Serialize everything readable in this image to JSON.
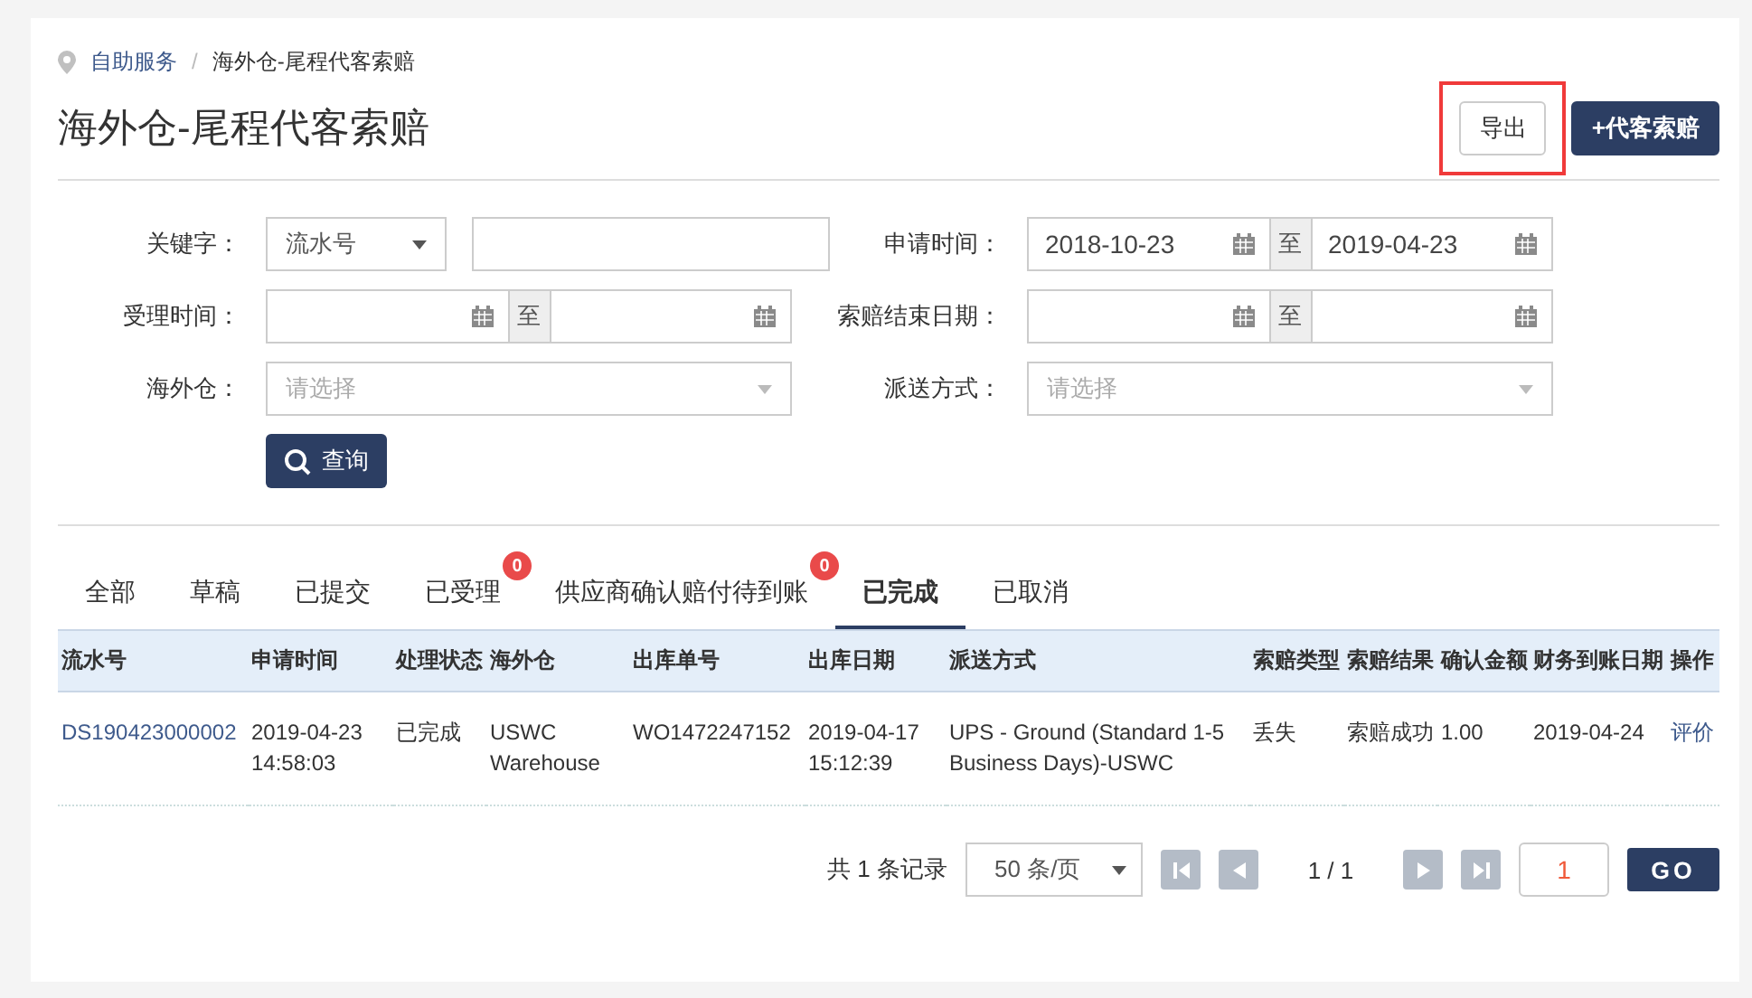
{
  "breadcrumb_separator": "/",
  "breadcrumb": [
    {
      "label": "自助服务",
      "link": true
    },
    {
      "label": "海外仓-尾程代客索赔",
      "link": false
    }
  ],
  "title": "海外仓-尾程代客索赔",
  "actions": [
    {
      "label": "导出",
      "kind": "outline",
      "highlighted": true
    },
    {
      "label": "+代客索赔",
      "kind": "primary",
      "highlighted": false
    }
  ],
  "filters": [
    {
      "label": "关键字：",
      "kind": "keyword",
      "select": "流水号"
    },
    {
      "label": "申请时间：",
      "kind": "daterange",
      "from": "2018-10-23",
      "sep": "至",
      "to": "2019-04-23"
    },
    {
      "label": "受理时间：",
      "kind": "daterange",
      "sep": "至"
    },
    {
      "label": "索赔结束日期：",
      "kind": "daterange",
      "sep": "至"
    },
    {
      "label": "海外仓：",
      "kind": "select",
      "placeholder": "请选择"
    },
    {
      "label": "派送方式：",
      "kind": "select",
      "placeholder": "请选择"
    }
  ],
  "search_button": "查询",
  "tabs": [
    {
      "label": "全部",
      "selected": false
    },
    {
      "label": "草稿",
      "selected": false
    },
    {
      "label": "已提交",
      "selected": false
    },
    {
      "label": "已受理",
      "selected": false,
      "badge": "0"
    },
    {
      "label": "供应商确认赔付待到账",
      "selected": false,
      "badge": "0"
    },
    {
      "label": "已完成",
      "selected": true
    },
    {
      "label": "已取消",
      "selected": false
    }
  ],
  "table": {
    "columns": [
      "流水号",
      "申请时间",
      "处理状态",
      "海外仓",
      "出库单号",
      "出库日期",
      "派送方式",
      "索赔类型",
      "索赔结果",
      "确认金额",
      "财务到账日期",
      "操作"
    ],
    "rows": [
      {
        "cells": [
          {
            "text": "DS190423000002",
            "kind": "link"
          },
          {
            "text": "2019-04-23 14:58:03",
            "kind": "text"
          },
          {
            "text": "已完成",
            "kind": "text"
          },
          {
            "text": "USWC Warehouse",
            "kind": "text"
          },
          {
            "text": "WO1472247152",
            "kind": "text"
          },
          {
            "text": "2019-04-17 15:12:39",
            "kind": "text"
          },
          {
            "text": "UPS - Ground (Standard 1-5 Business Days)-USWC",
            "kind": "text"
          },
          {
            "text": "丢失",
            "kind": "text"
          },
          {
            "text": "索赔成功",
            "kind": "text"
          },
          {
            "text": "1.00",
            "kind": "text"
          },
          {
            "text": "2019-04-24",
            "kind": "text"
          },
          {
            "text": "评价",
            "kind": "link"
          }
        ]
      }
    ]
  },
  "pagination": {
    "total": "共 1 条记录",
    "page_size": "50 条/页",
    "page": "1 / 1",
    "jump_value": "1",
    "go": "GO"
  }
}
